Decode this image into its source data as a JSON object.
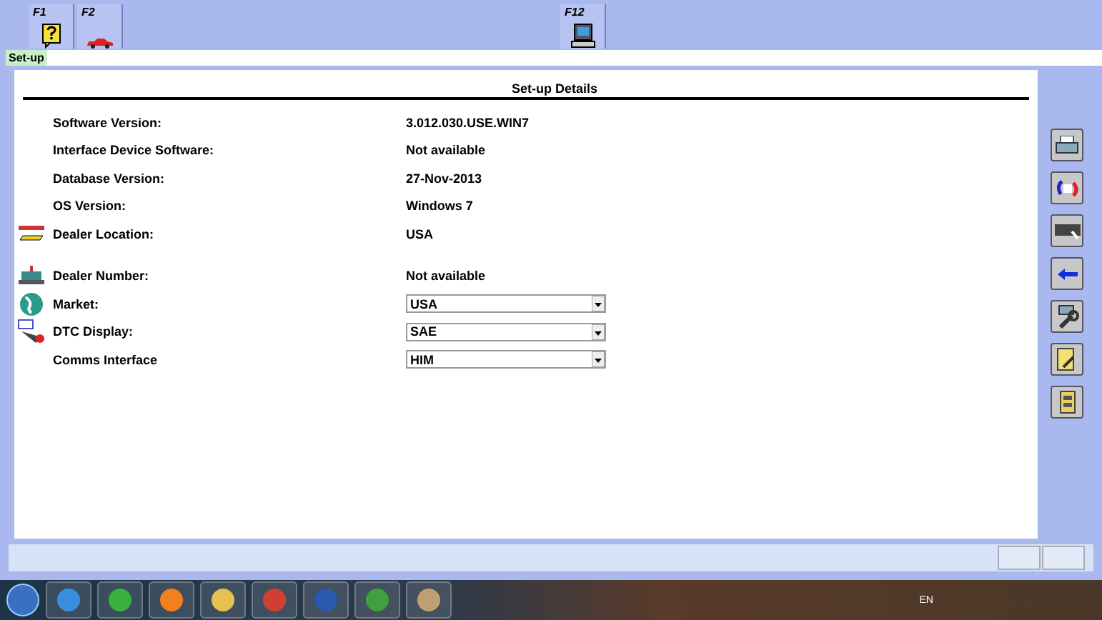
{
  "function_keys": [
    {
      "key": "F1"
    },
    {
      "key": "F2"
    },
    {
      "key": "F12"
    }
  ],
  "breadcrumb": "Set-up",
  "panel": {
    "title": "Set-up Details",
    "rows": [
      {
        "kind": "text",
        "label": "Software Version:",
        "value": "3.012.030.USE.WIN7"
      },
      {
        "kind": "text",
        "label": "Interface Device Software:",
        "value": "Not available"
      },
      {
        "kind": "text",
        "label": "Database Version:",
        "value": "27-Nov-2013"
      },
      {
        "kind": "text",
        "label": "OS Version:",
        "value": "Windows 7"
      },
      {
        "kind": "text",
        "label": "Dealer Location:",
        "value": "USA"
      },
      {
        "kind": "text",
        "label": "Dealer Number:",
        "value": "Not available"
      },
      {
        "kind": "dropdown",
        "label": "Market:",
        "value": "USA"
      },
      {
        "kind": "dropdown",
        "label": "DTC Display:",
        "value": "SAE"
      },
      {
        "kind": "dropdown",
        "label": "Comms Interface",
        "value": "HIM"
      }
    ]
  },
  "taskbar": {
    "language": "EN"
  }
}
